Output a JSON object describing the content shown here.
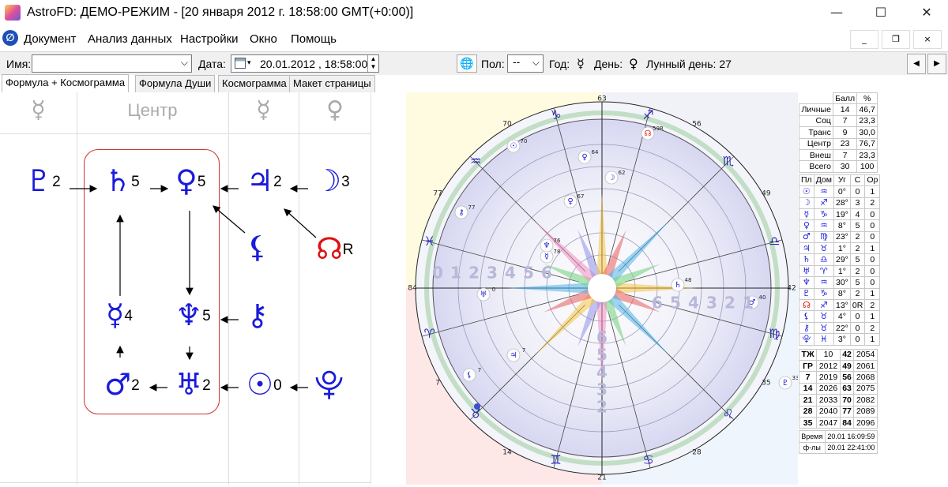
{
  "window": {
    "title": "AstroFD: ДЕМО-РЕЖИМ - [20 января 2012 г. 18:58:00 GMT(+0:00)]",
    "minimize_glyph": "—",
    "maximize_glyph": "☐",
    "close_glyph": "✕"
  },
  "menu": [
    "Документ",
    "Анализ данных",
    "Настройки",
    "Окно",
    "Помощь"
  ],
  "mdi": {
    "minimize": "_",
    "restore": "❐",
    "close": "×"
  },
  "toolbar": {
    "name_label": "Имя:",
    "name_value": "",
    "date_label": "Дата:",
    "date_value": "20.01.2012 , 18:58:00",
    "pol_label": "Пол:",
    "pol_value": "--",
    "god_label": "Год:",
    "god_symbol": "☿",
    "den_label": "День:",
    "den_symbol": "♀",
    "lunar_label": "Лунный день: 27",
    "prev": "◀",
    "next": "▶"
  },
  "tabs": [
    "Формула + Космограмма",
    "Формула Души",
    "Космограмма",
    "Макет страницы"
  ],
  "formula": {
    "headers": [
      "☿",
      "Центр",
      "☿",
      "♀"
    ],
    "planets": [
      {
        "name": "pluto",
        "sym": "♇",
        "num": "2"
      },
      {
        "name": "saturn",
        "sym": "♄",
        "num": "5"
      },
      {
        "name": "venus",
        "sym": "♀",
        "num": "5"
      },
      {
        "name": "jupiter",
        "sym": "♃",
        "num": "2"
      },
      {
        "name": "moon",
        "sym": "☽",
        "num": "3"
      },
      {
        "name": "lilith",
        "sym": "⚸",
        "num": ""
      },
      {
        "name": "node",
        "sym": "☊",
        "num": "R"
      },
      {
        "name": "mercury",
        "sym": "☿",
        "num": "4"
      },
      {
        "name": "neptune",
        "sym": "♆",
        "num": "5"
      },
      {
        "name": "chiron",
        "sym": "⚷",
        "num": ""
      },
      {
        "name": "mars",
        "sym": "♂",
        "num": "2"
      },
      {
        "name": "uranus",
        "sym": "♅",
        "num": "2"
      },
      {
        "name": "sun",
        "sym": "☉",
        "num": "0"
      },
      {
        "name": "proserpina",
        "sym": "⯓",
        "num": ""
      }
    ]
  },
  "chart": {
    "signs": [
      "♑",
      "♒",
      "♓",
      "♈",
      "♉",
      "♊",
      "♋",
      "♌",
      "♍",
      "♎",
      "♏",
      "♐"
    ],
    "outer_numbers": [
      "63",
      "56",
      "49",
      "42",
      "35",
      "28",
      "21",
      "14",
      "7",
      "84",
      "77",
      "70"
    ],
    "planets": [
      {
        "sym": "♄",
        "deg": "48"
      },
      {
        "sym": "♂",
        "deg": "40"
      },
      {
        "sym": "♇",
        "deg": "33"
      },
      {
        "sym": "♃",
        "deg": "7"
      },
      {
        "sym": "⚸",
        "deg": "7"
      },
      {
        "sym": "♅",
        "deg": "0"
      },
      {
        "sym": "☿",
        "deg": "78"
      },
      {
        "sym": "♆",
        "deg": "76"
      },
      {
        "sym": "♀",
        "deg": "67"
      },
      {
        "sym": "⚷",
        "deg": "77"
      },
      {
        "sym": "☉",
        "deg": "70"
      },
      {
        "sym": "♀",
        "deg": "64"
      },
      {
        "sym": "☽",
        "deg": "62"
      },
      {
        "sym": "☊",
        "deg": "59R"
      }
    ],
    "house_nums_left": [
      "0",
      "1",
      "2",
      "3",
      "4",
      "5",
      "6"
    ],
    "house_nums_right": [
      "6",
      "5",
      "4",
      "3",
      "2",
      "1"
    ],
    "house_nums_bottom": [
      "6",
      "5",
      "4",
      "3",
      "2"
    ]
  },
  "scores": {
    "headers": [
      "Балл",
      "%"
    ],
    "rows": [
      [
        "Личные",
        "14",
        "46,7"
      ],
      [
        "Соц",
        "7",
        "23,3"
      ],
      [
        "Транс",
        "9",
        "30,0"
      ],
      [
        "Центр",
        "23",
        "76,7"
      ],
      [
        "Внеш",
        "7",
        "23,3"
      ],
      [
        "Всего",
        "30",
        "100"
      ]
    ]
  },
  "positions": {
    "headers": [
      "Пл",
      "Дом",
      "Уг",
      "С",
      "Ор"
    ],
    "rows": [
      [
        "☉",
        "♒",
        "0°",
        "0",
        "1"
      ],
      [
        "☽",
        "♐",
        "28°",
        "3",
        "2"
      ],
      [
        "☿",
        "♑",
        "19°",
        "4",
        "0"
      ],
      [
        "♀",
        "♒",
        "8°",
        "5",
        "0"
      ],
      [
        "♂",
        "♍",
        "23°",
        "2",
        "0"
      ],
      [
        "♃",
        "♉",
        "1°",
        "2",
        "1"
      ],
      [
        "♄",
        "♎",
        "29°",
        "5",
        "0"
      ],
      [
        "♅",
        "♈",
        "1°",
        "2",
        "0"
      ],
      [
        "♆",
        "♒",
        "30°",
        "5",
        "0"
      ],
      [
        "♇",
        "♑",
        "8°",
        "2",
        "1"
      ],
      [
        "☊",
        "♐",
        "13°",
        "0R",
        "2"
      ],
      [
        "⚸",
        "♉",
        "4°",
        "0",
        "1"
      ],
      [
        "⚷",
        "♉",
        "22°",
        "0",
        "2"
      ],
      [
        "⯓",
        "♓",
        "3°",
        "0",
        "1"
      ]
    ]
  },
  "years": [
    [
      "ТЖ",
      "10",
      "42",
      "2054"
    ],
    [
      "ГР",
      "2012",
      "49",
      "2061"
    ],
    [
      "7",
      "2019",
      "56",
      "2068"
    ],
    [
      "14",
      "2026",
      "63",
      "2075"
    ],
    [
      "21",
      "2033",
      "70",
      "2082"
    ],
    [
      "28",
      "2040",
      "77",
      "2089"
    ],
    [
      "35",
      "2047",
      "84",
      "2096"
    ]
  ],
  "footer": {
    "time_label": "Время",
    "time_value": "20.01 16:09:59",
    "fl_label": "ф-лы",
    "fl_value": "20.01 22:41:00"
  }
}
